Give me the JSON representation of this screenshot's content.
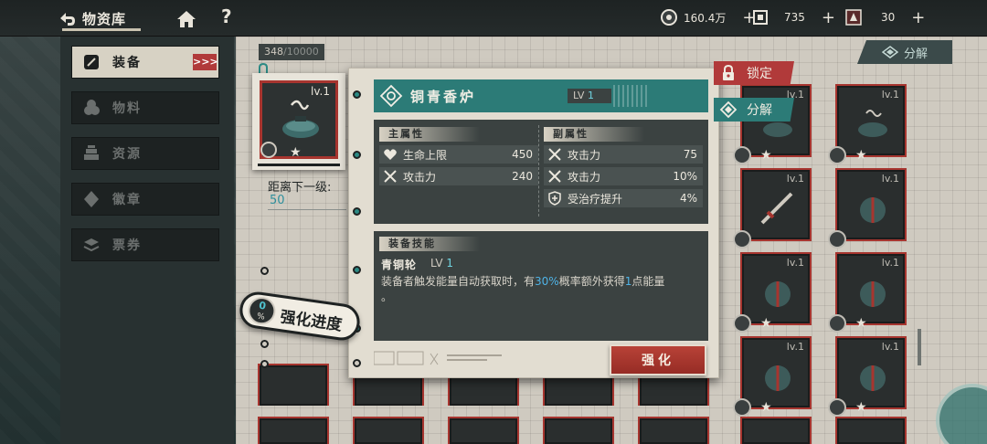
{
  "header": {
    "title": "物资库",
    "resources": [
      {
        "icon": "coin-icon",
        "value": "160.4万"
      },
      {
        "icon": "ticket-icon",
        "value": "735"
      },
      {
        "icon": "energy-icon",
        "value": "30"
      }
    ],
    "plus": "+"
  },
  "sidebar": {
    "items": [
      {
        "label": "装备",
        "icon": "equipment-icon",
        "active": true
      },
      {
        "label": "物料",
        "icon": "materials-icon",
        "active": false
      },
      {
        "label": "资源",
        "icon": "resources-icon",
        "active": false
      },
      {
        "label": "徽章",
        "icon": "badge-icon",
        "active": false
      },
      {
        "label": "票券",
        "icon": "coupon-icon",
        "active": false
      }
    ],
    "active_arrows": ">>>"
  },
  "storage": {
    "count": "348",
    "max": "/10000",
    "decompose_label": "分解",
    "items": [
      {
        "lv": "lv.1"
      },
      {
        "lv": "lv.1"
      },
      {
        "lv": "lv.1"
      },
      {
        "lv": "lv.1"
      },
      {
        "lv": "lv.1"
      },
      {
        "lv": "lv.1"
      },
      {
        "lv": "lv.1"
      },
      {
        "lv": "lv.1"
      }
    ]
  },
  "selected": {
    "lv": "lv.1",
    "distance_label": "距离下一级:",
    "distance_value": "50",
    "progress_pct": "0",
    "progress_sign": "%",
    "progress_label": "强化进度"
  },
  "detail": {
    "name": "铜青香炉",
    "lv_prefix": "LV",
    "lv_value": "1",
    "main_attr_title": "主属性",
    "sub_attr_title": "副属性",
    "main_attrs": [
      {
        "icon": "heart-icon",
        "label": "生命上限",
        "value": "450"
      },
      {
        "icon": "crossed-swords-icon",
        "label": "攻击力",
        "value": "240"
      }
    ],
    "sub_attrs": [
      {
        "icon": "crossed-swords-icon",
        "label": "攻击力",
        "value": "75"
      },
      {
        "icon": "crossed-swords-icon",
        "label": "攻击力",
        "value": "10%"
      },
      {
        "icon": "heal-shield-icon",
        "label": "受治疗提升",
        "value": "4%"
      }
    ],
    "skill_title": "装备技能",
    "skill_name": "青铜轮",
    "skill_lv_prefix": "LV",
    "skill_lv_value": "1",
    "skill_desc_1": "装备者触发能量自动获取时，有",
    "skill_desc_pct": "30%",
    "skill_desc_2": "概率额外获得",
    "skill_desc_num": "1",
    "skill_desc_3": "点能量",
    "skill_desc_4": "。",
    "enhance_button": "强化"
  },
  "actions": {
    "lock_label": "锁定",
    "decompose_label": "分解"
  },
  "colors": {
    "accent_red": "#b13a3a",
    "accent_teal": "#2c7b77",
    "highlight_blue": "#4fb3e6"
  }
}
